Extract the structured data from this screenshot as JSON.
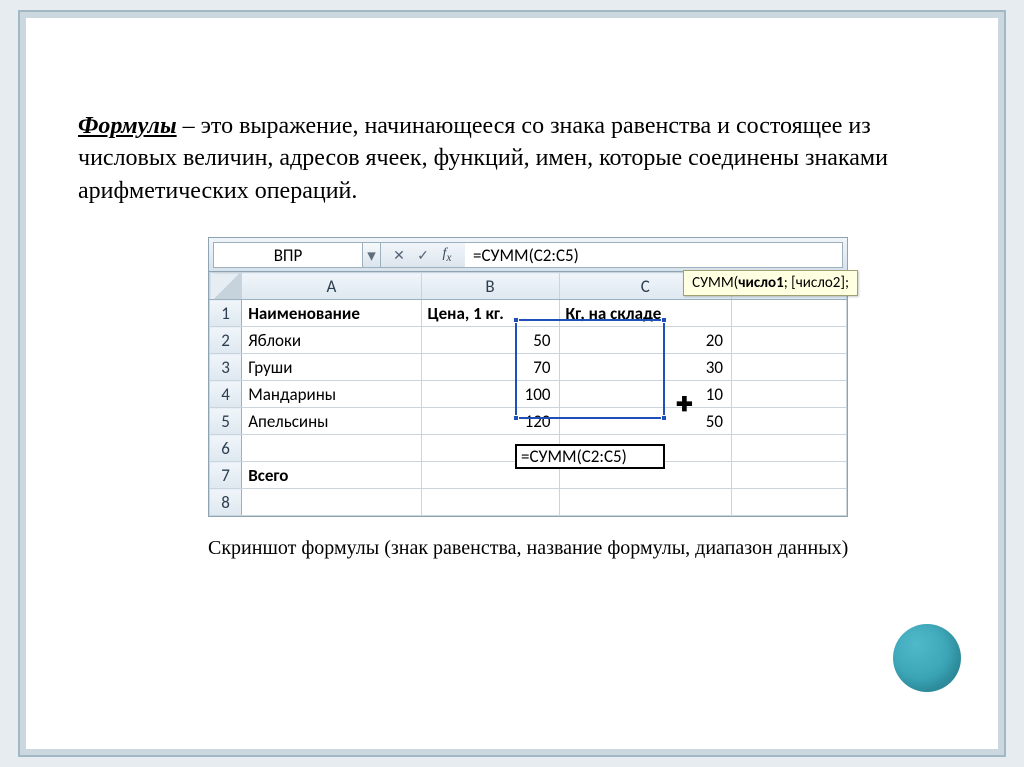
{
  "heading_keyword": "Формулы",
  "heading_rest": " – это выражение, начинающееся со знака равенства и состоящее из числовых величин, адресов ячеек, функций, имен, которые соединены знаками арифметических операций.",
  "excel": {
    "name_box": "ВПР",
    "formula_input": "=СУММ(C2:C5)",
    "tooltip_fn": "СУММ(",
    "tooltip_bold": "число1",
    "tooltip_rest": "; [число2];",
    "columns": [
      "A",
      "B",
      "C"
    ],
    "row_numbers": [
      "1",
      "2",
      "3",
      "4",
      "5",
      "6",
      "7",
      "8"
    ],
    "header_row": {
      "A": "Наименование",
      "B": "Цена, 1 кг.",
      "C": "Кг, на складе"
    },
    "data_rows": [
      {
        "A": "Яблоки",
        "B": "50",
        "C": "20"
      },
      {
        "A": "Груши",
        "B": "70",
        "C": "30"
      },
      {
        "A": "Мандарины",
        "B": "100",
        "C": "10"
      },
      {
        "A": "Апельсины",
        "B": "120",
        "C": "50"
      }
    ],
    "total_label": "Всего",
    "active_cell_value": "=СУММ(C2:C5)"
  },
  "caption": "Скриншот формулы (знак равенства, название формулы, диапазон данных)"
}
